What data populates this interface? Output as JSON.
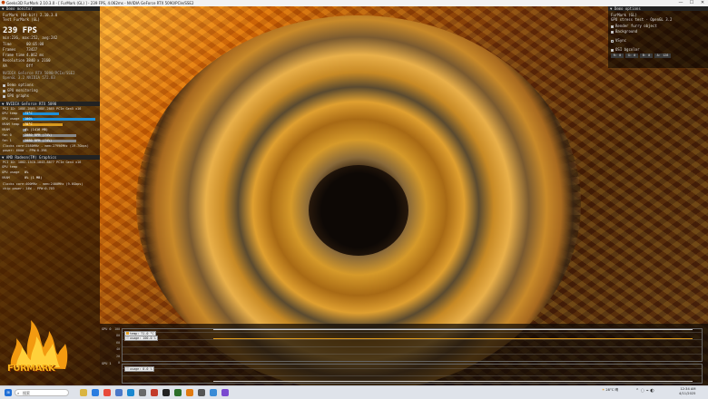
{
  "window": {
    "title": "Geeks3D FurMark 2.10.3.0 - [ FurMark (GL) ] - 239 FPS, 4.062ms - NVIDIA GeForce RTX 5090/PCIe/SSE2",
    "minimize": "—",
    "maximize": "☐",
    "close": "✕"
  },
  "left_panel": {
    "header": "Demo monitor",
    "app_line": "FurMark (64-bit) 2.10.3.0",
    "test_line": "Test FurMark (GL)",
    "fps": "239 FPS",
    "fps_stats": "min:236, max:252, avg:242",
    "stats": [
      {
        "k": "Time",
        "v": "00:05:08"
      },
      {
        "k": "Frames",
        "v": "73427"
      },
      {
        "k": "Frame time",
        "v": "4.062 ms"
      },
      {
        "k": "Resolution",
        "v": "3840 x 2160"
      },
      {
        "k": "AA",
        "v": "Off"
      }
    ],
    "renderer_line1": "NVIDIA GeForce RTX 5090/PCIe/SSE2",
    "renderer_line2": "OpenGL 3.2 NVIDIA 572.83",
    "options": [
      {
        "label": "Demo options",
        "checked": true
      },
      {
        "label": "GPU monitoring",
        "checked": true
      },
      {
        "label": "GPU graphs",
        "checked": true
      }
    ],
    "gpu1": {
      "header": "NVIDIA GeForce RTX 5090",
      "pci_id": "PCI ID: 10DE-2B85-10DE-2B85 PCIe Gen5 x16",
      "rows": [
        {
          "k": "GPU temp",
          "v": "73°C",
          "pct": 0.5,
          "color": "#1e8fd8"
        },
        {
          "k": "GPU usage",
          "v": "100%",
          "pct": 1.0,
          "color": "#1e8fd8"
        },
        {
          "k": "VRAM temp",
          "v": "78°C",
          "pct": 0.55,
          "color": "#d89a1e"
        },
        {
          "k": "VRAM",
          "v": "4% (1416 MB)",
          "pct": 0.05,
          "color": "#888"
        },
        {
          "k": "fan 0",
          "v": "2080 RPM (74%)",
          "pct": 0.74,
          "color": "#888"
        },
        {
          "k": "fan 1",
          "v": "2080 RPM (74%)",
          "pct": 0.74,
          "color": "#888"
        }
      ],
      "clocks": "Clocks core:2580MHz - mem:27996MHz (19.7Gbps)",
      "power": "power: 600W - PPW:0.398"
    },
    "gpu2": {
      "header": "AMD Radeon(TM) Graphics",
      "pci_id": "PCI ID: 1002-13C0-1043-8877 PCIe Gen4 x16",
      "rows": [
        {
          "k": "GPU temp",
          "v": "-",
          "pct": 0.0,
          "color": "#888"
        },
        {
          "k": "GPU usage",
          "v": "0%",
          "pct": 0.0,
          "color": "#888"
        },
        {
          "k": "VRAM",
          "v": "0% (1 MB)",
          "pct": 0.0,
          "color": "#888"
        }
      ],
      "clocks": "Clocks core:400MHz - mem:2400MHz (9.6Gbps)",
      "power": "chip power: 14W - PPW:0.703"
    }
  },
  "right_panel": {
    "header": "Demo options",
    "line1": "FurMark (GL)",
    "line2": "GPU stress test - OpenGL 3.2",
    "options": [
      {
        "label": "Render furry object",
        "checked": true
      },
      {
        "label": "Background",
        "checked": true
      },
      {
        "label": "VSync",
        "checked": false
      },
      {
        "label": "OSI bgcolor",
        "checked": true
      }
    ],
    "rgba": [
      "R: 0",
      "G: 0",
      "B: 0",
      "A: 128"
    ]
  },
  "graphs": {
    "gpu0": {
      "tag": "GPU 0",
      "axis": [
        "100",
        "80",
        "60",
        "40",
        "20",
        "0"
      ],
      "legend_temp": "temp: 71.0 °C",
      "legend_usage": "usage: 100.0 %",
      "temp_value": 71.0,
      "usage_value": 100.0
    },
    "gpu1": {
      "tag": "GPU 1",
      "axis": [
        "100",
        "80",
        "60",
        "40",
        "20",
        "0"
      ],
      "legend_usage": "usage: 0.0 %",
      "usage_value": 0.0
    }
  },
  "logo": {
    "text": "FURMARK"
  },
  "taskbar": {
    "search": "搜索",
    "weather_temp": "28°C",
    "weather_text": "晴",
    "time": "12:34 AM",
    "date": "4/11/2025",
    "apps": [
      "file-explorer",
      "edge",
      "chrome",
      "store",
      "mail",
      "settings",
      "photos",
      "terminal",
      "gpu-z",
      "furmark",
      "obs",
      "media",
      "chat"
    ]
  }
}
